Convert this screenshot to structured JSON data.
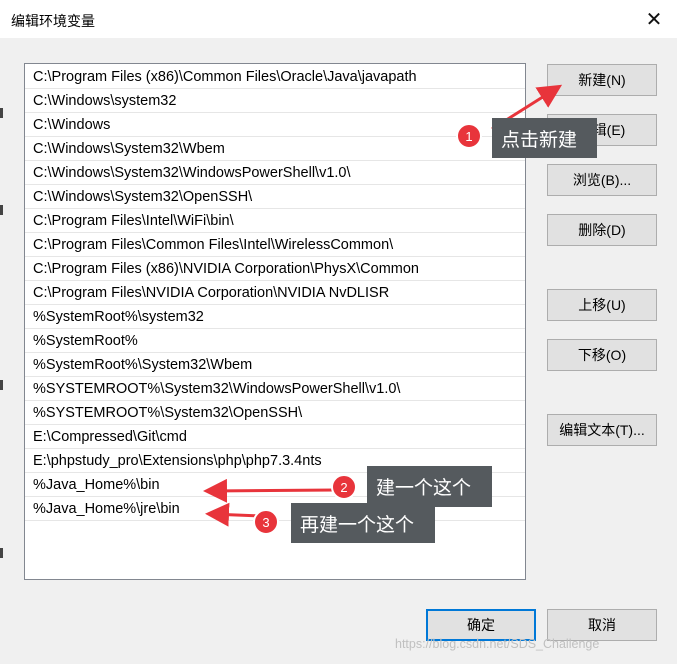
{
  "window": {
    "title": "编辑环境变量",
    "close_glyph": "✕"
  },
  "path_list": {
    "items": [
      "C:\\Program Files (x86)\\Common Files\\Oracle\\Java\\javapath",
      "C:\\Windows\\system32",
      "C:\\Windows",
      "C:\\Windows\\System32\\Wbem",
      "C:\\Windows\\System32\\WindowsPowerShell\\v1.0\\",
      "C:\\Windows\\System32\\OpenSSH\\",
      "C:\\Program Files\\Intel\\WiFi\\bin\\",
      "C:\\Program Files\\Common Files\\Intel\\WirelessCommon\\",
      "C:\\Program Files (x86)\\NVIDIA Corporation\\PhysX\\Common",
      "C:\\Program Files\\NVIDIA Corporation\\NVIDIA NvDLISR",
      "%SystemRoot%\\system32",
      "%SystemRoot%",
      "%SystemRoot%\\System32\\Wbem",
      "%SYSTEMROOT%\\System32\\WindowsPowerShell\\v1.0\\",
      "%SYSTEMROOT%\\System32\\OpenSSH\\",
      "E:\\Compressed\\Git\\cmd",
      "E:\\phpstudy_pro\\Extensions\\php\\php7.3.4nts",
      "%Java_Home%\\bin",
      "%Java_Home%\\jre\\bin"
    ]
  },
  "buttons": {
    "new": "新建(N)",
    "edit": "编辑(E)",
    "browse": "浏览(B)...",
    "delete": "删除(D)",
    "move_up": "上移(U)",
    "move_down": "下移(O)",
    "edit_text": "编辑文本(T)...",
    "ok": "确定",
    "cancel": "取消"
  },
  "annotations": {
    "callout_1": {
      "number": "1",
      "text": "点击新建"
    },
    "callout_2": {
      "number": "2",
      "text": "建一个这个"
    },
    "callout_3": {
      "number": "3",
      "text": "再建一个这个"
    }
  },
  "watermark": "https://blog.csdn.net/SDS_Challenge",
  "colors": {
    "annotation_red": "#e8343b",
    "callout_bg": "#555a5e",
    "focus_blue": "#0078d7"
  }
}
